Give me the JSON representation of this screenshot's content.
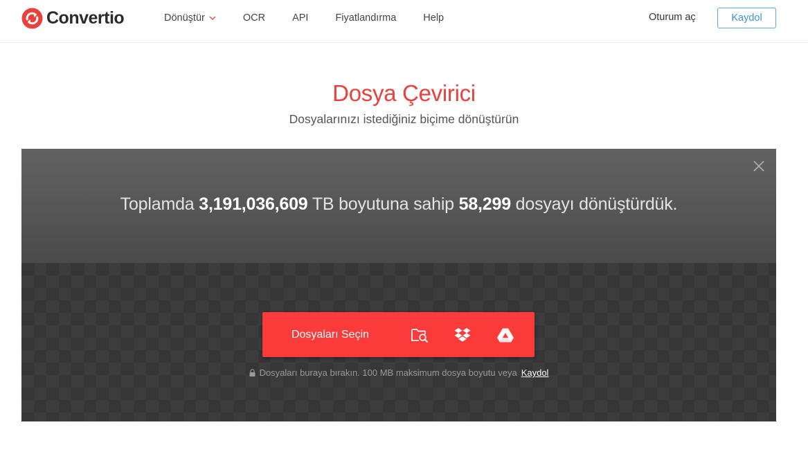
{
  "brand": {
    "name": "Convertio",
    "color": "#e8413e"
  },
  "nav": {
    "items": [
      {
        "label": "Dönüştür",
        "icon": "chevron-down-icon"
      },
      {
        "label": "OCR"
      },
      {
        "label": "API"
      },
      {
        "label": "Fiyatlandırma"
      },
      {
        "label": "Help"
      }
    ],
    "login_label": "Oturum aç",
    "signup_label": "Kaydol"
  },
  "hero": {
    "title": "Dosya Çevirici",
    "subtitle": "Dosyalarınızı istediğiniz biçime dönüştürün"
  },
  "stats": {
    "prefix": "Toplamda",
    "total_size": "3,191,036,609",
    "middle": "TB boyutuna sahip",
    "file_count": "58,299",
    "suffix": "dosyayı dönüştürdük."
  },
  "upload": {
    "choose_label": "Dosyaları Seçin",
    "sources": [
      {
        "icon": "folder-search-icon"
      },
      {
        "icon": "dropbox-icon"
      },
      {
        "icon": "google-drive-icon"
      }
    ],
    "hint_text": "Dosyaları buraya bırakın. 100 MB maksimum dosya boyutu veya",
    "hint_link": "Kaydol",
    "button_color": "#fb3a3a"
  }
}
